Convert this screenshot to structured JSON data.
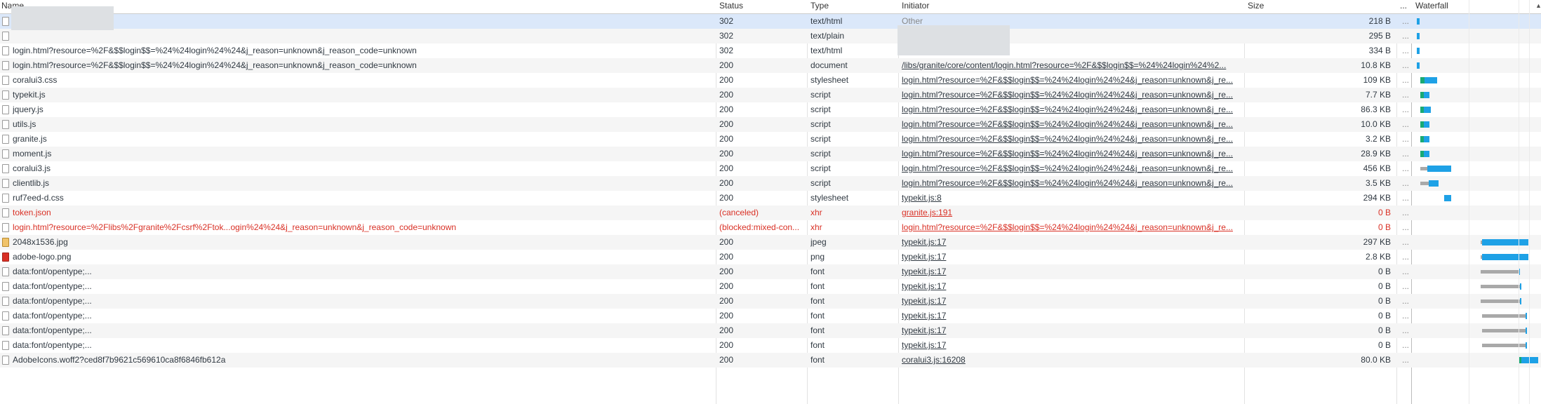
{
  "columns": {
    "name": "Name",
    "status": "Status",
    "type": "Type",
    "initiator": "Initiator",
    "size": "Size",
    "more": "...",
    "waterfall": "Waterfall"
  },
  "rows": [
    {
      "name": "",
      "status": "302",
      "type": "text/html",
      "initiator": "Other",
      "initiator_style": "plain-gray",
      "size": "218 B",
      "more": "...",
      "icon": "file-icon",
      "state": "selected",
      "wf": [
        {
          "l": 3,
          "w": 4,
          "c": "blue"
        }
      ]
    },
    {
      "name": "",
      "status": "302",
      "type": "text/plain",
      "initiator": "",
      "initiator_style": "plain",
      "size": "295 B",
      "more": "...",
      "icon": "file-icon",
      "state": "",
      "wf": [
        {
          "l": 3,
          "w": 4,
          "c": "blue"
        }
      ]
    },
    {
      "name": "login.html?resource=%2F&$$login$$=%24%24login%24%24&j_reason=unknown&j_reason_code=unknown",
      "status": "302",
      "type": "text/html",
      "initiator": "",
      "initiator_style": "plain",
      "size": "334 B",
      "more": "...",
      "icon": "file-icon",
      "state": "",
      "wf": [
        {
          "l": 3,
          "w": 4,
          "c": "blue"
        }
      ]
    },
    {
      "name": "login.html?resource=%2F&$$login$$=%24%24login%24%24&j_reason=unknown&j_reason_code=unknown",
      "status": "200",
      "type": "document",
      "initiator": "/libs/granite/core/content/login.html?resource=%2F&$$login$$=%24%24login%24%2...",
      "initiator_style": "link",
      "size": "10.8 KB",
      "more": "...",
      "icon": "file-icon",
      "state": "",
      "wf": [
        {
          "l": 3,
          "w": 4,
          "c": "blue"
        }
      ]
    },
    {
      "name": "coralui3.css",
      "status": "200",
      "type": "stylesheet",
      "initiator": "login.html?resource=%2F&$$login$$=%24%24login%24%24&j_reason=unknown&j_re...",
      "initiator_style": "link",
      "size": "109 KB",
      "more": "...",
      "icon": "file-icon",
      "state": "",
      "wf": [
        {
          "l": 8,
          "w": 6,
          "c": "green"
        },
        {
          "l": 14,
          "w": 18,
          "c": "blue"
        }
      ]
    },
    {
      "name": "typekit.js",
      "status": "200",
      "type": "script",
      "initiator": "login.html?resource=%2F&$$login$$=%24%24login%24%24&j_reason=unknown&j_re...",
      "initiator_style": "link",
      "size": "7.7 KB",
      "more": "...",
      "icon": "file-icon",
      "state": "",
      "wf": [
        {
          "l": 8,
          "w": 5,
          "c": "green"
        },
        {
          "l": 13,
          "w": 8,
          "c": "blue"
        }
      ]
    },
    {
      "name": "jquery.js",
      "status": "200",
      "type": "script",
      "initiator": "login.html?resource=%2F&$$login$$=%24%24login%24%24&j_reason=unknown&j_re...",
      "initiator_style": "link",
      "size": "86.3 KB",
      "more": "...",
      "icon": "file-icon",
      "state": "",
      "wf": [
        {
          "l": 8,
          "w": 5,
          "c": "green"
        },
        {
          "l": 13,
          "w": 10,
          "c": "blue"
        }
      ]
    },
    {
      "name": "utils.js",
      "status": "200",
      "type": "script",
      "initiator": "login.html?resource=%2F&$$login$$=%24%24login%24%24&j_reason=unknown&j_re...",
      "initiator_style": "link",
      "size": "10.0 KB",
      "more": "...",
      "icon": "file-icon",
      "state": "",
      "wf": [
        {
          "l": 8,
          "w": 5,
          "c": "green"
        },
        {
          "l": 13,
          "w": 8,
          "c": "blue"
        }
      ]
    },
    {
      "name": "granite.js",
      "status": "200",
      "type": "script",
      "initiator": "login.html?resource=%2F&$$login$$=%24%24login%24%24&j_reason=unknown&j_re...",
      "initiator_style": "link",
      "size": "3.2 KB",
      "more": "...",
      "icon": "file-icon",
      "state": "",
      "wf": [
        {
          "l": 8,
          "w": 5,
          "c": "green"
        },
        {
          "l": 13,
          "w": 8,
          "c": "blue"
        }
      ]
    },
    {
      "name": "moment.js",
      "status": "200",
      "type": "script",
      "initiator": "login.html?resource=%2F&$$login$$=%24%24login%24%24&j_reason=unknown&j_re...",
      "initiator_style": "link",
      "size": "28.9 KB",
      "more": "...",
      "icon": "file-icon",
      "state": "",
      "wf": [
        {
          "l": 8,
          "w": 5,
          "c": "green"
        },
        {
          "l": 13,
          "w": 8,
          "c": "blue"
        }
      ]
    },
    {
      "name": "coralui3.js",
      "status": "200",
      "type": "script",
      "initiator": "login.html?resource=%2F&$$login$$=%24%24login%24%24&j_reason=unknown&j_re...",
      "initiator_style": "link",
      "size": "456 KB",
      "more": "...",
      "icon": "file-icon",
      "state": "",
      "wf": [
        {
          "l": 8,
          "w": 10,
          "c": "gray"
        },
        {
          "l": 18,
          "w": 34,
          "c": "blue"
        }
      ]
    },
    {
      "name": "clientlib.js",
      "status": "200",
      "type": "script",
      "initiator": "login.html?resource=%2F&$$login$$=%24%24login%24%24&j_reason=unknown&j_re...",
      "initiator_style": "link",
      "size": "3.5 KB",
      "more": "...",
      "icon": "file-icon",
      "state": "",
      "wf": [
        {
          "l": 8,
          "w": 12,
          "c": "gray"
        },
        {
          "l": 20,
          "w": 14,
          "c": "blue"
        }
      ]
    },
    {
      "name": "ruf7eed-d.css",
      "status": "200",
      "type": "stylesheet",
      "initiator": "typekit.js:8",
      "initiator_style": "link",
      "size": "294 KB",
      "more": "...",
      "icon": "file-icon",
      "state": "",
      "wf": [
        {
          "l": 42,
          "w": 10,
          "c": "blue"
        }
      ]
    },
    {
      "name": "token.json",
      "status": "(canceled)",
      "type": "xhr",
      "initiator": "granite.js:191",
      "initiator_style": "link",
      "size": "0 B",
      "more": "...",
      "icon": "file-icon",
      "state": "error",
      "wf": []
    },
    {
      "name": "login.html?resource=%2Flibs%2Fgranite%2Fcsrf%2Ftok...ogin%24%24&j_reason=unknown&j_reason_code=unknown",
      "status": "(blocked:mixed-con...",
      "type": "xhr",
      "initiator": "login.html?resource=%2F&$$login$$=%24%24login%24%24&j_reason=unknown&j_re...",
      "initiator_style": "link",
      "size": "0 B",
      "more": "...",
      "icon": "file-icon",
      "state": "error",
      "wf": []
    },
    {
      "name": "2048x1536.jpg",
      "status": "200",
      "type": "jpeg",
      "initiator": "typekit.js:17",
      "initiator_style": "link",
      "size": "297 KB",
      "more": "...",
      "icon": "image-file-icon",
      "state": "",
      "wf": [
        {
          "l": 94,
          "w": 2,
          "c": "gray"
        },
        {
          "l": 96,
          "w": 66,
          "c": "blue"
        }
      ]
    },
    {
      "name": "adobe-logo.png",
      "status": "200",
      "type": "png",
      "initiator": "typekit.js:17",
      "initiator_style": "link",
      "size": "2.8 KB",
      "more": "...",
      "icon": "red-image-file-icon",
      "state": "",
      "wf": [
        {
          "l": 94,
          "w": 2,
          "c": "gray"
        },
        {
          "l": 96,
          "w": 66,
          "c": "blue"
        }
      ]
    },
    {
      "name": "data:font/opentype;...",
      "status": "200",
      "type": "font",
      "initiator": "typekit.js:17",
      "initiator_style": "link",
      "size": "0 B",
      "more": "...",
      "icon": "file-icon",
      "state": "",
      "wf": [
        {
          "l": 94,
          "w": 54,
          "c": "gray"
        },
        {
          "l": 148,
          "w": 2,
          "c": "blue"
        }
      ]
    },
    {
      "name": "data:font/opentype;...",
      "status": "200",
      "type": "font",
      "initiator": "typekit.js:17",
      "initiator_style": "link",
      "size": "0 B",
      "more": "...",
      "icon": "file-icon",
      "state": "",
      "wf": [
        {
          "l": 94,
          "w": 56,
          "c": "gray"
        },
        {
          "l": 150,
          "w": 2,
          "c": "blue"
        }
      ]
    },
    {
      "name": "data:font/opentype;...",
      "status": "200",
      "type": "font",
      "initiator": "typekit.js:17",
      "initiator_style": "link",
      "size": "0 B",
      "more": "...",
      "icon": "file-icon",
      "state": "",
      "wf": [
        {
          "l": 94,
          "w": 56,
          "c": "gray"
        },
        {
          "l": 150,
          "w": 2,
          "c": "blue"
        }
      ]
    },
    {
      "name": "data:font/opentype;...",
      "status": "200",
      "type": "font",
      "initiator": "typekit.js:17",
      "initiator_style": "link",
      "size": "0 B",
      "more": "...",
      "icon": "file-icon",
      "state": "",
      "wf": [
        {
          "l": 96,
          "w": 62,
          "c": "gray"
        },
        {
          "l": 158,
          "w": 2,
          "c": "blue"
        }
      ]
    },
    {
      "name": "data:font/opentype;...",
      "status": "200",
      "type": "font",
      "initiator": "typekit.js:17",
      "initiator_style": "link",
      "size": "0 B",
      "more": "...",
      "icon": "file-icon",
      "state": "",
      "wf": [
        {
          "l": 96,
          "w": 62,
          "c": "gray"
        },
        {
          "l": 158,
          "w": 2,
          "c": "blue"
        }
      ]
    },
    {
      "name": "data:font/opentype;...",
      "status": "200",
      "type": "font",
      "initiator": "typekit.js:17",
      "initiator_style": "link",
      "size": "0 B",
      "more": "...",
      "icon": "file-icon",
      "state": "",
      "wf": [
        {
          "l": 96,
          "w": 62,
          "c": "gray"
        },
        {
          "l": 158,
          "w": 2,
          "c": "blue"
        }
      ]
    },
    {
      "name": "AdobeIcons.woff2?ced8f7b9621c569610ca8f6846fb612a",
      "status": "200",
      "type": "font",
      "initiator": "coralui3.js:16208",
      "initiator_style": "link",
      "size": "80.0 KB",
      "more": "...",
      "icon": "file-icon",
      "state": "",
      "wf": [
        {
          "l": 148,
          "w": 4,
          "c": "green"
        },
        {
          "l": 152,
          "w": 24,
          "c": "blue"
        }
      ]
    }
  ],
  "colors": {
    "selected_row": "#dbe8fa",
    "striped_row": "#f5f5f5",
    "error_text": "#d93025",
    "waterfall_blue": "#1ea1e6",
    "waterfall_green": "#19a974",
    "waterfall_gray": "#a9a9a9"
  }
}
